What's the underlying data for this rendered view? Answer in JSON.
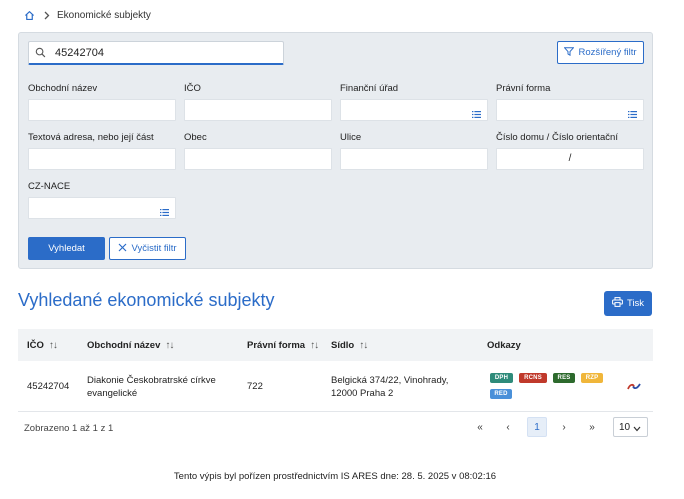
{
  "breadcrumb": {
    "current": "Ekonomické subjekty"
  },
  "search": {
    "value": "45242704"
  },
  "filter": {
    "advanced_label": "Rozšířený filtr",
    "fields": {
      "obchodni_nazev": "Obchodní název",
      "ico": "IČO",
      "financni_urad": "Finanční úřad",
      "pravni_forma": "Právní forma",
      "textova_adresa": "Textová adresa, nebo její část",
      "obec": "Obec",
      "ulice": "Ulice",
      "cislo_domu": "Číslo domu / Číslo orientační",
      "cz_nace": "CZ-NACE"
    },
    "cislo_separator": "/",
    "search_label": "Vyhledat",
    "clear_label": "Vyčistit filtr"
  },
  "results": {
    "title": "Vyhledané ekonomické subjekty",
    "print_label": "Tisk",
    "columns": {
      "ico": "IČO",
      "obchodni_nazev": "Obchodní název",
      "pravni_forma": "Právní forma",
      "sidlo": "Sídlo",
      "odkazy": "Odkazy"
    },
    "rows": [
      {
        "ico": "45242704",
        "name_line1": "Diakonie Českobratrské církve",
        "name_line2": "evangelické",
        "pravni_forma": "722",
        "sidlo_line1": "Belgická 374/22, Vinohrady,",
        "sidlo_line2": "12000 Praha 2",
        "badges": [
          {
            "label": "DPH",
            "color": "#2e8b7a"
          },
          {
            "label": "RCNS",
            "color": "#c0392b"
          },
          {
            "label": "RES",
            "color": "#2d6a2d"
          },
          {
            "label": "RZP",
            "color": "#f0b63a"
          },
          {
            "label": "RED",
            "color": "#4a90d9"
          }
        ]
      }
    ],
    "shown": "Zobrazeno 1 až 1 z 1",
    "pagination": {
      "first": "«",
      "prev": "‹",
      "current": "1",
      "next": "›",
      "last": "»"
    },
    "page_size": "10"
  },
  "footer": {
    "stamp": "Tento výpis byl pořízen prostřednictvím IS ARES dne: 28. 5. 2025 v 08:02:16"
  },
  "colors": {
    "accent": "#2b6cc8",
    "panel": "#e8ecf0"
  }
}
